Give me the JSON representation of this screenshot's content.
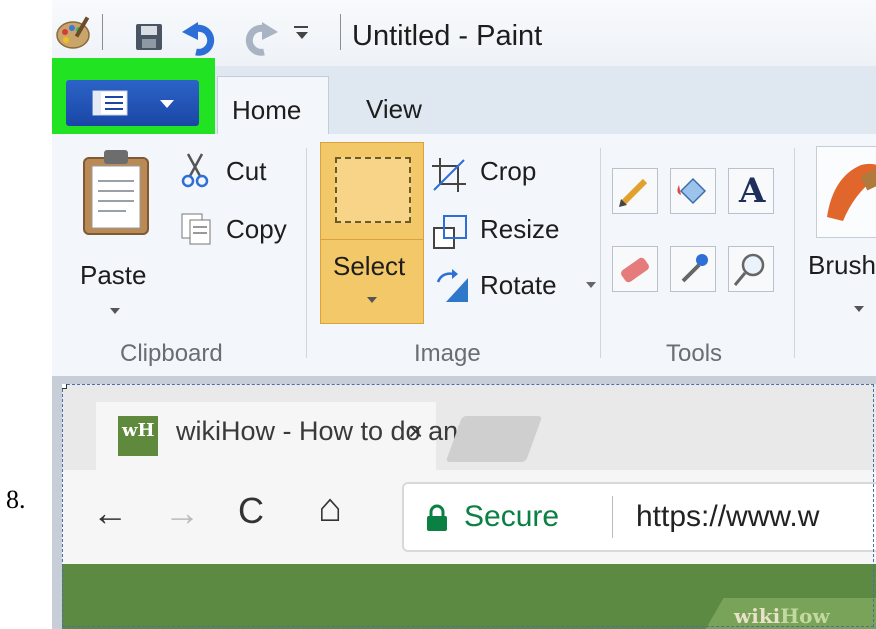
{
  "step_number": "8.",
  "window": {
    "title": "Untitled - Paint"
  },
  "ribbon": {
    "tabs": [
      "Home",
      "View"
    ],
    "clipboard": {
      "paste": "Paste",
      "cut": "Cut",
      "copy": "Copy",
      "group_label": "Clipboard"
    },
    "image": {
      "select": "Select",
      "crop": "Crop",
      "resize": "Resize",
      "rotate": "Rotate",
      "group_label": "Image"
    },
    "tools": {
      "group_label": "Tools",
      "text_tool_glyph": "A"
    },
    "brushes": {
      "label": "Brush"
    }
  },
  "browser": {
    "tab_title": "wikiHow - How to do any",
    "tab_close": "×",
    "favicon_text": "wH",
    "nav": {
      "back": "←",
      "forward": "→",
      "reload": "C",
      "home": "⌂"
    },
    "secure_label": "Secure",
    "url": "https://www.w",
    "site_logo": {
      "part1": "wiki",
      "part2": "How"
    }
  },
  "colors": {
    "highlight": "#22e322",
    "file_button": "#1a47a6",
    "select_active": "#f3c868",
    "site_header": "#5c8a43"
  }
}
